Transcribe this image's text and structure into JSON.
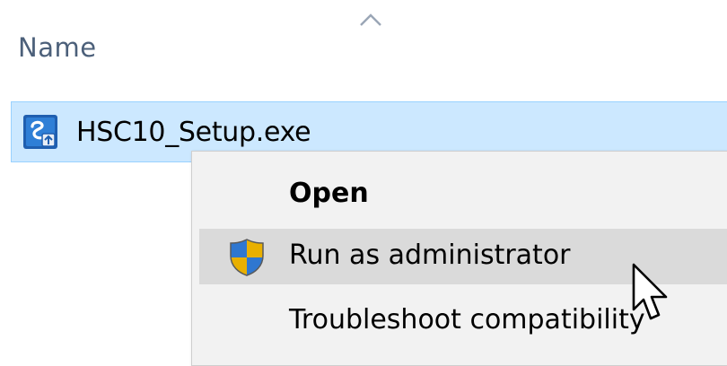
{
  "column_header": {
    "label": "Name",
    "sort_icon": "chevron-up-icon"
  },
  "file": {
    "name": "HSC10_Setup.exe",
    "icon": "installer-icon",
    "selected": true
  },
  "context_menu": {
    "items": [
      {
        "label": "Open",
        "bold": true,
        "icon": null
      },
      {
        "label": "Run as administrator",
        "bold": false,
        "icon": "uac-shield-icon",
        "hovered": true
      },
      {
        "label": "Troubleshoot compatibility",
        "bold": false,
        "icon": null
      }
    ]
  },
  "colors": {
    "selection_fill": "#cce8ff",
    "selection_border": "#99d1ff",
    "menu_background": "#f2f2f2",
    "menu_hover": "#dadada",
    "header_text": "#4c607a"
  }
}
